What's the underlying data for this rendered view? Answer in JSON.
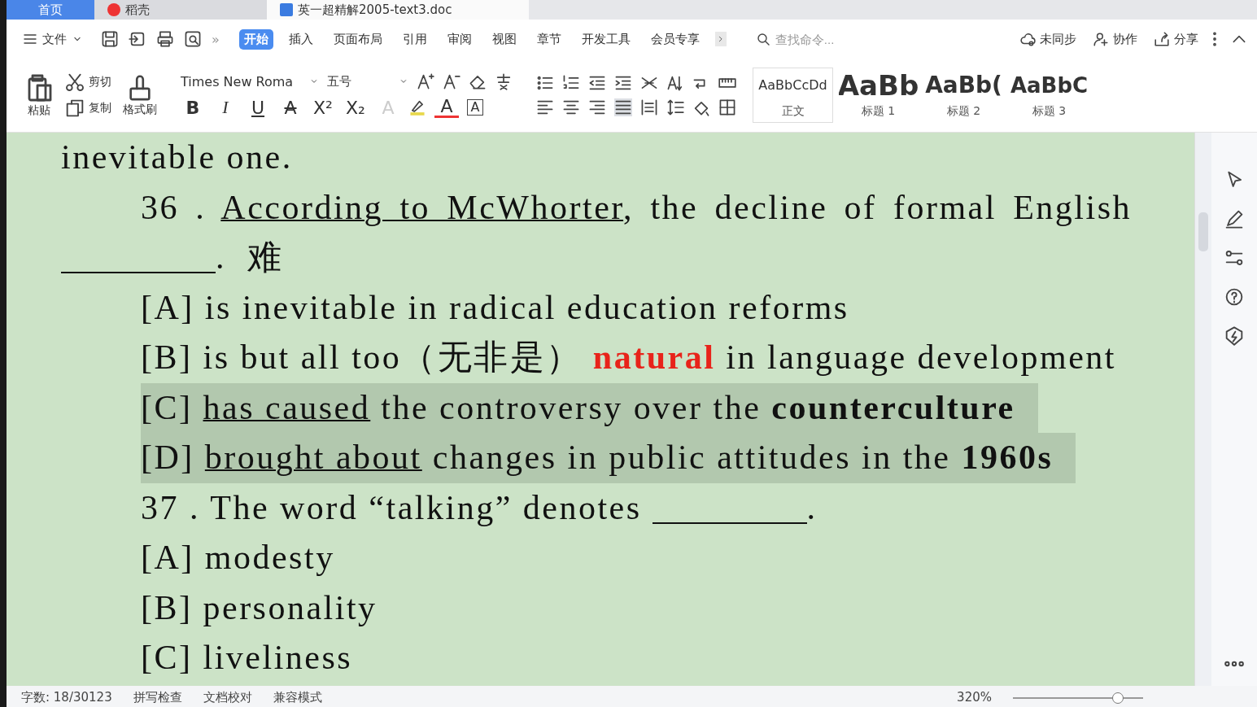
{
  "tabs": [
    {
      "label": "首页",
      "kind": "home",
      "selected": false
    },
    {
      "label": "稻壳",
      "kind": "app",
      "selected": false
    },
    {
      "label": "英一超精解2005-text3.doc",
      "kind": "doc",
      "selected": true
    }
  ],
  "menu": {
    "file": "文件",
    "more": "»",
    "items": [
      {
        "label": "开始",
        "selected": true
      },
      {
        "label": "插入",
        "selected": false
      },
      {
        "label": "页面布局",
        "selected": false
      },
      {
        "label": "引用",
        "selected": false
      },
      {
        "label": "审阅",
        "selected": false
      },
      {
        "label": "视图",
        "selected": false
      },
      {
        "label": "章节",
        "selected": false
      },
      {
        "label": "开发工具",
        "selected": false
      },
      {
        "label": "会员专享",
        "selected": false
      }
    ],
    "search": {
      "placeholder": "查找命令..."
    },
    "actions": [
      {
        "label": "未同步",
        "kind": "cloud"
      },
      {
        "label": "协作",
        "kind": "person"
      },
      {
        "label": "分享",
        "kind": "share"
      }
    ]
  },
  "ribbon": {
    "paste": "粘贴",
    "cut": "剪切",
    "copy": "复制",
    "painter": "格式刷",
    "font": "Times New Roma",
    "size": "五号",
    "format_buttons": [
      {
        "label": "B",
        "kind": "bold"
      },
      {
        "label": "I",
        "kind": "italic"
      },
      {
        "label": "U",
        "kind": "underline"
      },
      {
        "label": "A",
        "kind": "strike"
      },
      {
        "label": "X²",
        "kind": "plain"
      },
      {
        "label": "X₂",
        "kind": "plain"
      },
      {
        "label": "A",
        "kind": "faded"
      },
      {
        "label": "A",
        "kind": "color"
      },
      {
        "label": "A",
        "kind": "boxed"
      }
    ],
    "styles": [
      {
        "preview": "AaBbCcDd",
        "label": "正文",
        "kind": "normal",
        "selected": true
      },
      {
        "preview": "AaBb",
        "label": "标题 1",
        "kind": "h1",
        "selected": false
      },
      {
        "preview": "AaBb(",
        "label": "标题 2",
        "kind": "h2",
        "selected": false
      },
      {
        "preview": "AaBbC",
        "label": "标题 3",
        "kind": "h3",
        "selected": false
      }
    ]
  },
  "document": {
    "lines": [
      {
        "indent": false,
        "justified": false,
        "highlighted": false,
        "segments": [
          {
            "kind": "plain",
            "text": "inevitable one."
          }
        ]
      },
      {
        "indent": true,
        "justified": true,
        "highlighted": false,
        "segments": [
          {
            "kind": "plain",
            "text": "36 . "
          },
          {
            "kind": "underline",
            "text": "According to McWhorter"
          },
          {
            "kind": "plain",
            "text": ", the decline of formal English"
          }
        ]
      },
      {
        "indent": false,
        "justified": false,
        "highlighted": false,
        "segments": [
          {
            "kind": "blank"
          },
          {
            "kind": "plain",
            "text": ".  难"
          }
        ]
      },
      {
        "indent": true,
        "justified": false,
        "highlighted": false,
        "segments": [
          {
            "kind": "plain",
            "text": "[A] is inevitable in radical education reforms"
          }
        ]
      },
      {
        "indent": true,
        "justified": false,
        "highlighted": false,
        "segments": [
          {
            "kind": "plain",
            "text": "[B] is but all too（无非是） "
          },
          {
            "kind": "red",
            "text": "natural"
          },
          {
            "kind": "plain",
            "text": " in language development"
          }
        ]
      },
      {
        "indent": true,
        "justified": false,
        "highlighted": true,
        "segments": [
          {
            "kind": "plain",
            "text": "[C] "
          },
          {
            "kind": "underline",
            "text": "has caused"
          },
          {
            "kind": "plain",
            "text": " the controversy over the "
          },
          {
            "kind": "bold",
            "text": "counterculture"
          }
        ]
      },
      {
        "indent": true,
        "justified": false,
        "highlighted": true,
        "segments": [
          {
            "kind": "plain",
            "text": "[D] "
          },
          {
            "kind": "underline",
            "text": "brought about"
          },
          {
            "kind": "plain",
            "text": " changes in public attitudes in the "
          },
          {
            "kind": "bold",
            "text": "1960s"
          }
        ]
      },
      {
        "indent": true,
        "justified": false,
        "highlighted": false,
        "segments": [
          {
            "kind": "plain",
            "text": "37 . The word “talking” denotes "
          },
          {
            "kind": "blank"
          },
          {
            "kind": "plain",
            "text": "."
          }
        ]
      },
      {
        "indent": true,
        "justified": false,
        "highlighted": false,
        "segments": [
          {
            "kind": "plain",
            "text": "[A] modesty"
          }
        ]
      },
      {
        "indent": true,
        "justified": false,
        "highlighted": false,
        "segments": [
          {
            "kind": "plain",
            "text": "[B] personality"
          }
        ]
      },
      {
        "indent": true,
        "justified": false,
        "highlighted": false,
        "segments": [
          {
            "kind": "plain",
            "text": "[C] liveliness"
          }
        ]
      }
    ]
  },
  "status_bar": {
    "items": [
      "字数: 18/30123",
      "拼写检查",
      "文档校对",
      "兼容模式"
    ],
    "zoom": {
      "label": "320%",
      "level": 0.8
    }
  }
}
